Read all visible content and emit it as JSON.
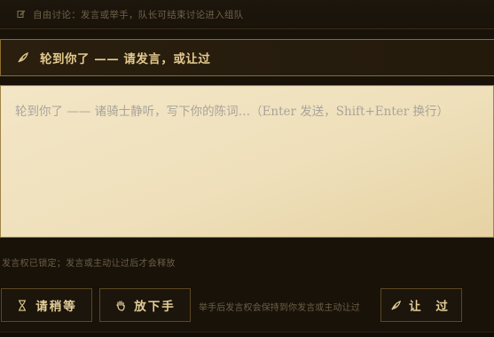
{
  "top_bar": {
    "icon": "edit-icon",
    "text": "自由讨论：发言或举手，队长可结束讨论进入组队"
  },
  "turn_banner": {
    "icon": "feather-icon",
    "text": "轮到你了 —— 请发言，或让过"
  },
  "speech": {
    "placeholder": "轮到你了 —— 诸骑士静听，写下你的陈词…（Enter 发送，Shift+Enter 换行）",
    "value": ""
  },
  "lock_note": "发言权已锁定；发言或主动让过后才会释放",
  "actions": {
    "wait": {
      "icon": "hourglass-icon",
      "label": "请稍等"
    },
    "lower_hand": {
      "icon": "hand-icon",
      "label": "放下手"
    },
    "hand_note": "举手后发言权会保持到你发言或主动让过",
    "pass": {
      "icon": "feather-icon",
      "label": "让 过"
    }
  },
  "colors": {
    "background": "#181209",
    "gold_text": "#e3c98f",
    "parchment": "#f0e2bd",
    "border_gold": "#8a6c2e"
  }
}
